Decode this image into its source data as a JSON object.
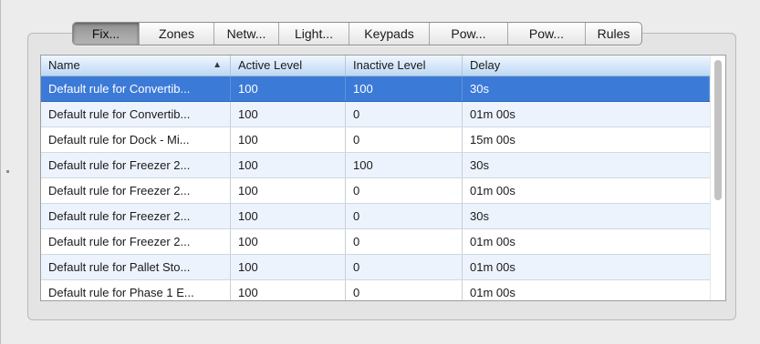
{
  "tabs": [
    {
      "label": "Fix...",
      "selected": true
    },
    {
      "label": "Zones",
      "selected": false
    },
    {
      "label": "Netw...",
      "selected": false
    },
    {
      "label": "Light...",
      "selected": false
    },
    {
      "label": "Keypads",
      "selected": false
    },
    {
      "label": "Pow...",
      "selected": false
    },
    {
      "label": "Pow...",
      "selected": false
    },
    {
      "label": "Rules",
      "selected": false
    }
  ],
  "table": {
    "columns": [
      "Name",
      "Active Level",
      "Inactive Level",
      "Delay"
    ],
    "sorted_column": "Name",
    "sort_direction": "ascending",
    "rows": [
      {
        "name": "Default rule for Convertib...",
        "active": "100",
        "inactive": "100",
        "delay": "30s",
        "selected": true
      },
      {
        "name": "Default rule for Convertib...",
        "active": "100",
        "inactive": "0",
        "delay": "01m 00s",
        "selected": false
      },
      {
        "name": "Default rule for Dock - Mi...",
        "active": "100",
        "inactive": "0",
        "delay": "15m 00s",
        "selected": false
      },
      {
        "name": "Default rule for Freezer 2...",
        "active": "100",
        "inactive": "100",
        "delay": "30s",
        "selected": false
      },
      {
        "name": "Default rule for Freezer 2...",
        "active": "100",
        "inactive": "0",
        "delay": "01m 00s",
        "selected": false
      },
      {
        "name": "Default rule for Freezer 2...",
        "active": "100",
        "inactive": "0",
        "delay": "30s",
        "selected": false
      },
      {
        "name": "Default rule for Freezer 2...",
        "active": "100",
        "inactive": "0",
        "delay": "01m 00s",
        "selected": false
      },
      {
        "name": "Default rule for Pallet Sto...",
        "active": "100",
        "inactive": "0",
        "delay": "01m 00s",
        "selected": false
      },
      {
        "name": "Default rule for Phase 1 E...",
        "active": "100",
        "inactive": "0",
        "delay": "01m 00s",
        "selected": false
      }
    ]
  },
  "colors": {
    "selection": "#3c7ad7",
    "alt_row": "#edf3fd",
    "header_top": "#f0f7ff",
    "header_bottom": "#bcd8f3"
  },
  "icons": {
    "sort": "sort-ascending-icon"
  }
}
